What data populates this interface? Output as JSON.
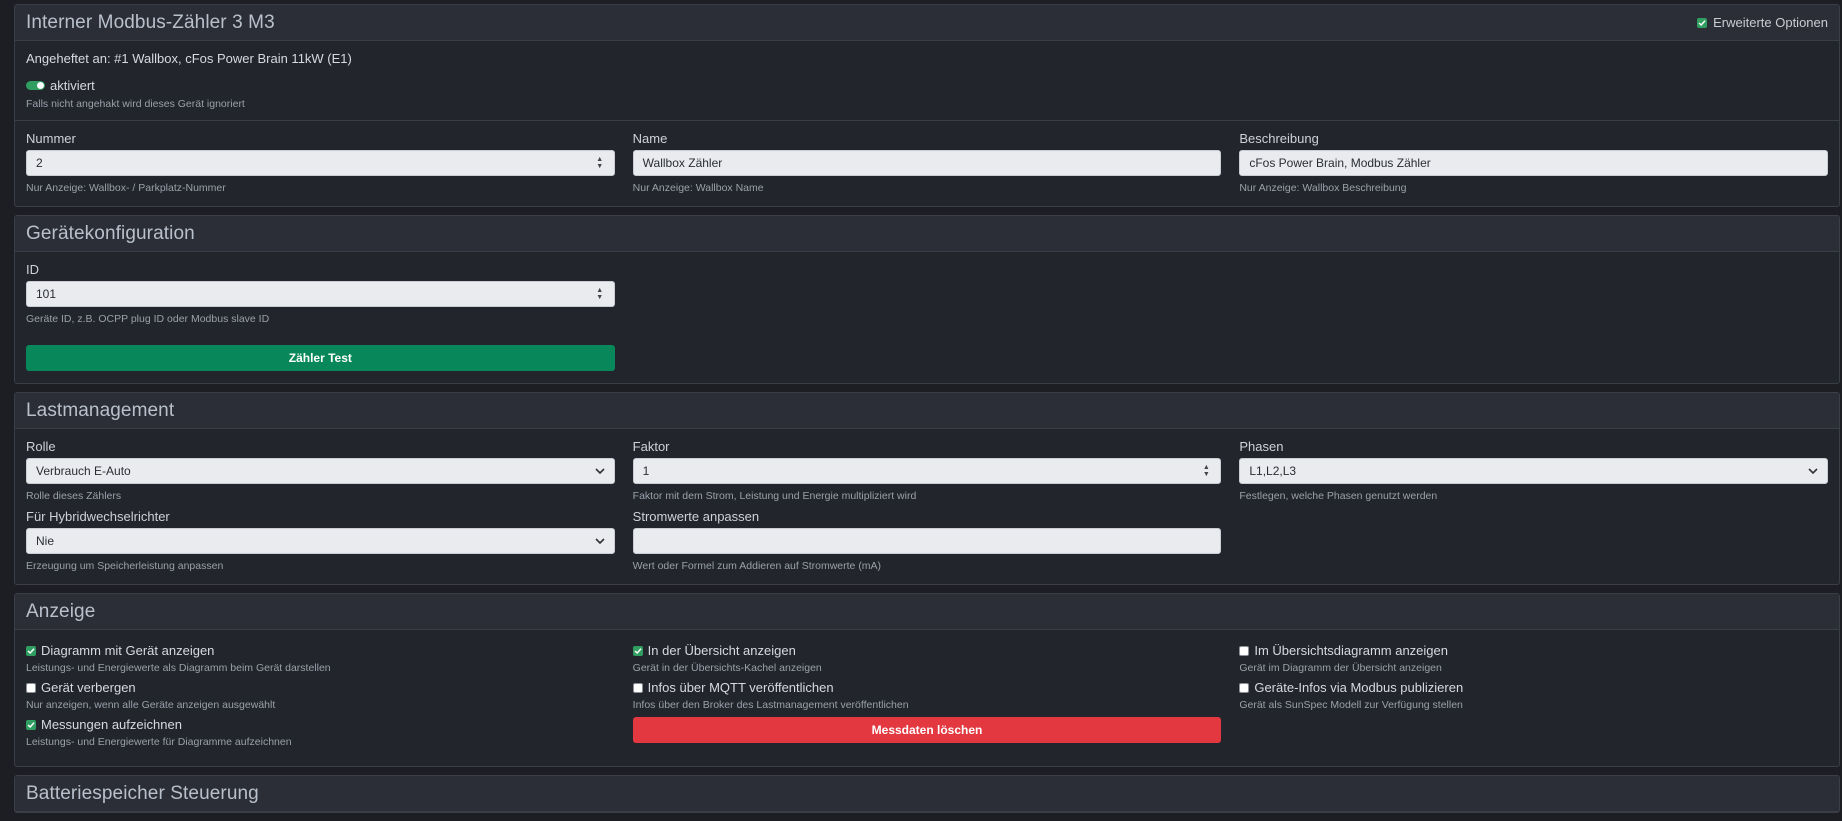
{
  "device": {
    "title": "Interner Modbus-Zähler 3 M3",
    "advanced_label": "Erweiterte Optionen",
    "attached": "Angeheftet an: #1 Wallbox, cFos Power Brain 11kW (E1)",
    "enabled_label": "aktiviert",
    "enabled_hint": "Falls nicht angehakt wird dieses Gerät ignoriert",
    "fields": {
      "number": {
        "label": "Nummer",
        "value": "2",
        "hint": "Nur Anzeige: Wallbox- / Parkplatz-Nummer"
      },
      "name": {
        "label": "Name",
        "value": "Wallbox Zähler",
        "hint": "Nur Anzeige: Wallbox Name"
      },
      "description": {
        "label": "Beschreibung",
        "value": "cFos Power Brain, Modbus Zähler",
        "hint": "Nur Anzeige: Wallbox Beschreibung"
      }
    }
  },
  "config": {
    "title": "Gerätekonfiguration",
    "id_label": "ID",
    "id_value": "101",
    "id_hint": "Geräte ID, z.B. OCPP plug ID oder Modbus slave ID",
    "test_button": "Zähler Test"
  },
  "load": {
    "title": "Lastmanagement",
    "role": {
      "label": "Rolle",
      "value": "Verbrauch E-Auto",
      "hint": "Rolle dieses Zählers"
    },
    "factor": {
      "label": "Faktor",
      "value": "1",
      "hint": "Faktor mit dem Strom, Leistung und Energie multipliziert wird"
    },
    "phases": {
      "label": "Phasen",
      "value": "L1,L2,L3",
      "hint": "Festlegen, welche Phasen genutzt werden"
    },
    "hybrid": {
      "label": "Für Hybridwechselrichter",
      "value": "Nie",
      "hint": "Erzeugung um Speicherleistung anpassen"
    },
    "current_adjust": {
      "label": "Stromwerte anpassen",
      "value": "",
      "hint": "Wert oder Formel zum Addieren auf Stromwerte (mA)"
    }
  },
  "display": {
    "title": "Anzeige",
    "chart": {
      "label": "Diagramm mit Gerät anzeigen",
      "hint": "Leistungs- und Energiewerte als Diagramm beim Gerät darstellen",
      "checked": true
    },
    "overview": {
      "label": "In der Übersicht anzeigen",
      "hint": "Gerät in der Übersichts-Kachel anzeigen",
      "checked": true
    },
    "overview_chart": {
      "label": "Im Übersichtsdiagramm anzeigen",
      "hint": "Gerät im Diagramm der Übersicht anzeigen",
      "checked": false
    },
    "hide": {
      "label": "Gerät verbergen",
      "hint": "Nur anzeigen, wenn alle Geräte anzeigen ausgewählt",
      "checked": false
    },
    "mqtt": {
      "label": "Infos über MQTT veröffentlichen",
      "hint": "Infos über den Broker des Lastmanagement veröffentlichen",
      "checked": false
    },
    "modbus": {
      "label": "Geräte-Infos via Modbus publizieren",
      "hint": "Gerät als SunSpec Modell zur Verfügung stellen",
      "checked": false
    },
    "record": {
      "label": "Messungen aufzeichnen",
      "hint": "Leistungs- und Energiewerte für Diagramme aufzeichnen",
      "checked": true
    },
    "delete_button": "Messdaten löschen"
  },
  "battery": {
    "title": "Batteriespeicher Steuerung"
  },
  "colors": {
    "accent_green": "#08885a",
    "danger_red": "#e3383f",
    "check_green": "#2f9e60"
  }
}
